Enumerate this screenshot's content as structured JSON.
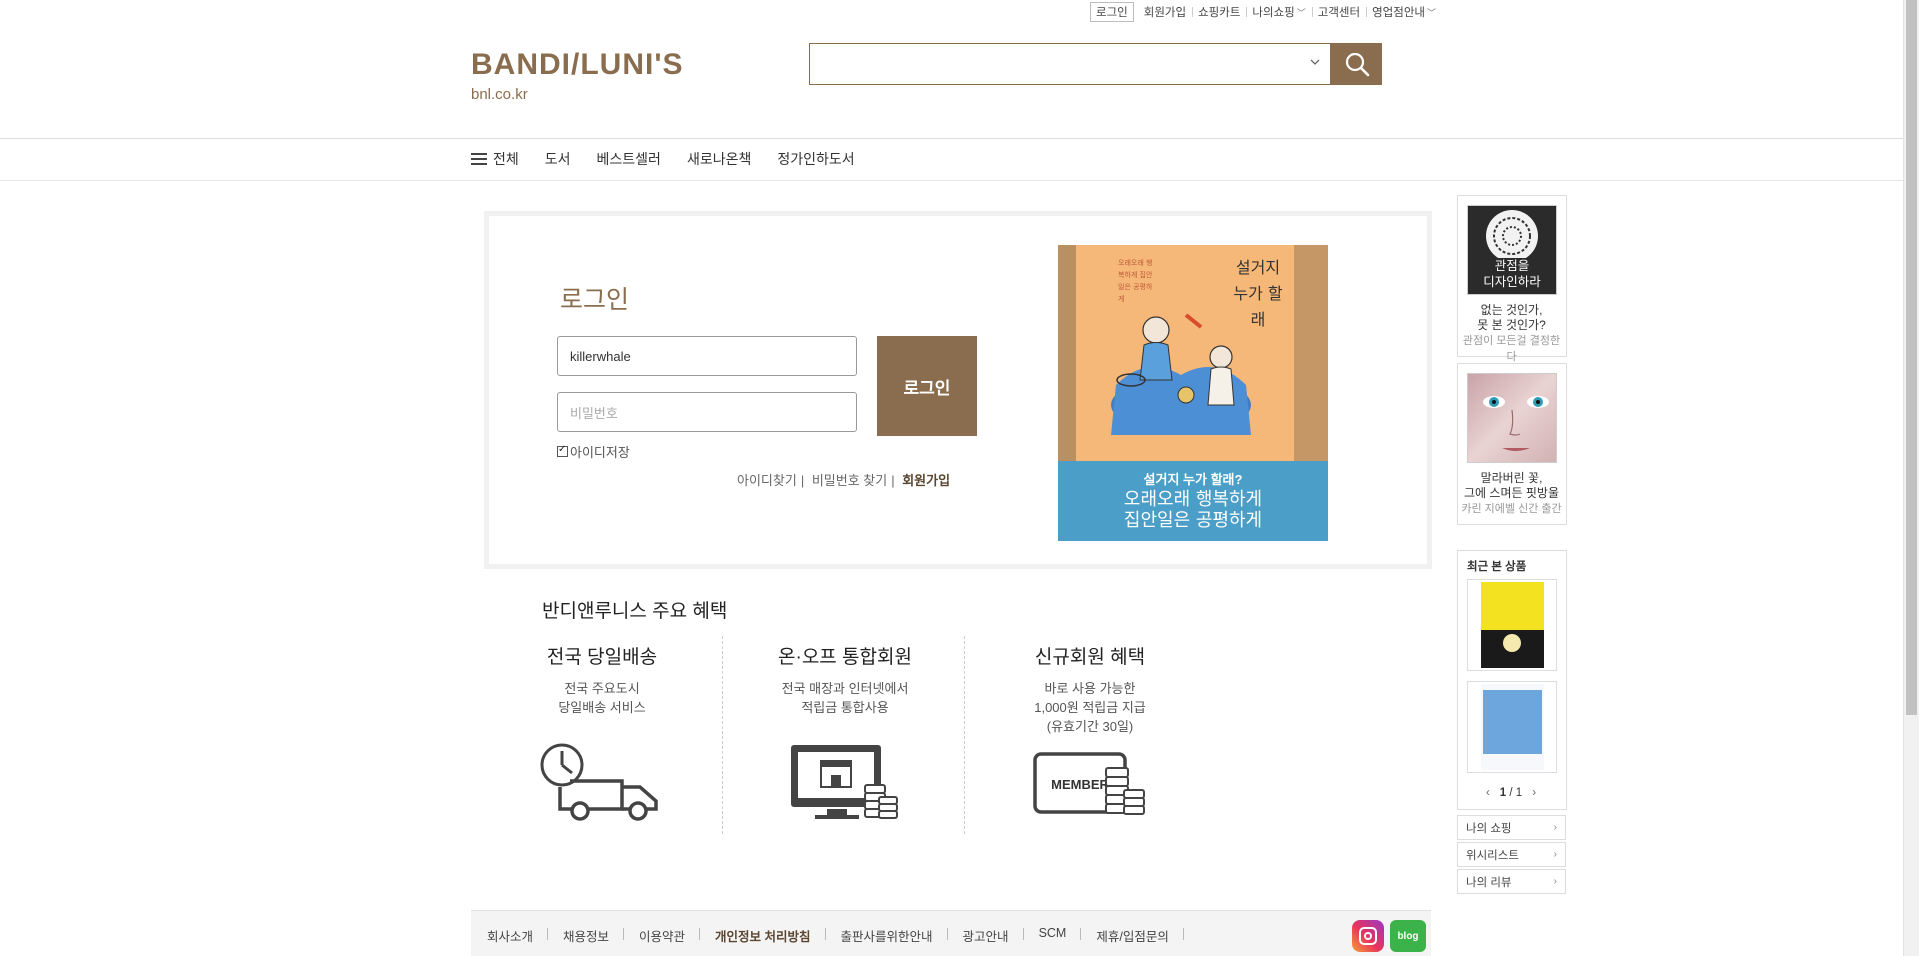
{
  "util_links": {
    "login": "로그인",
    "signup": "회원가입",
    "cart": "쇼핑카트",
    "my_shopping": "나의쇼핑",
    "support": "고객센터",
    "stores": "영업점안내"
  },
  "logo": {
    "name": "BANDI/LUNI'S",
    "sub": "bnl.co.kr"
  },
  "search": {
    "value": "",
    "dropdown_icon": "chevron-down-icon",
    "button_icon": "search-icon"
  },
  "nav": {
    "all": "전체",
    "items": [
      "도서",
      "베스트셀러",
      "새로나온책",
      "정가인하도서"
    ]
  },
  "login": {
    "title": "로그인",
    "id_value": "killerwhale",
    "pw_placeholder": "비밀번호",
    "button": "로그인",
    "save_id": "아이디저장",
    "find_id": "아이디찾기",
    "find_pw": "비밀번호 찾기",
    "join": "회원가입"
  },
  "banner": {
    "book_title": "설거지 누가 할래",
    "cover_small": "오래오래 행복하게 집안일은 공평하게",
    "caption_title": "설거지 누가 할래?",
    "caption_line1": "오래오래 행복하게",
    "caption_line2": "집안일은 공평하게"
  },
  "benefits": {
    "title": "반디앤루니스 주요 혜택",
    "items": [
      {
        "title": "전국 당일배송",
        "desc1": "전국 주요도시",
        "desc2": "당일배송 서비스",
        "desc3": "",
        "icon": "truck-clock-icon"
      },
      {
        "title": "온·오프 통합회원",
        "desc1": "전국 매장과 인터넷에서",
        "desc2": "적립금 통합사용",
        "desc3": "",
        "icon": "monitor-store-coins-icon"
      },
      {
        "title": "신규회원 혜택",
        "desc1": "바로 사용 가능한",
        "desc2": "1,000원 적립금 지급",
        "desc3": "(유효기간 30일)",
        "icon": "member-card-coins-icon",
        "card_text": "MEMBER"
      }
    ]
  },
  "sidebar": {
    "ad1": {
      "img_text1": "관점을",
      "img_text2": "디자인하라",
      "line1": "없는 것인가,",
      "line2": "못 본 것인가?",
      "line3": "관점이 모든걸 결정한다"
    },
    "ad2": {
      "line1": "말라버린 꽃,",
      "line2": "그에 스며든 핏방울",
      "line3": "카린 지에벨 신간 출간"
    },
    "recent_title": "최근 본 상품",
    "pager_current": "1",
    "pager_total": "1",
    "links": [
      "나의 쇼핑",
      "위시리스트",
      "나의 리뷰"
    ]
  },
  "footer": {
    "links": [
      "회사소개",
      "채용정보",
      "이용약관",
      "개인정보 처리방침",
      "출판사를위한안내",
      "광고안내",
      "SCM",
      "제휴/입점문의"
    ],
    "bold_index": 3,
    "blog_label": "blog"
  },
  "colors": {
    "brand": "#8a6d4f",
    "banner_blue": "#4a9ec7"
  }
}
